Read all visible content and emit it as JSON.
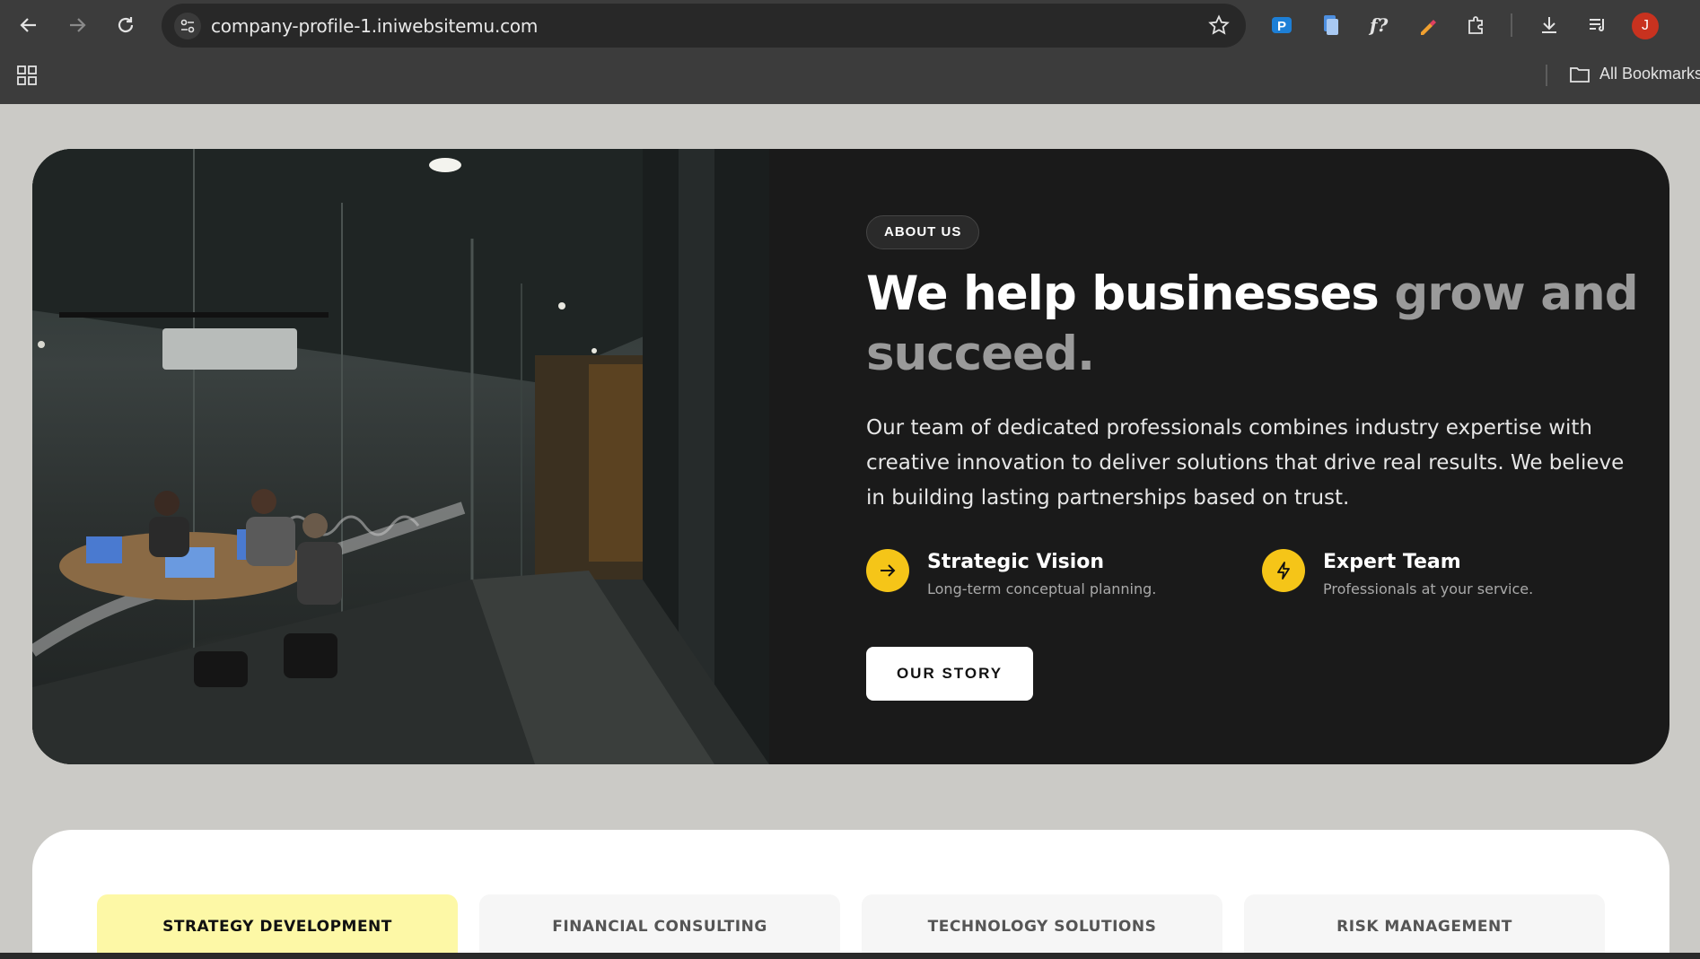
{
  "browser": {
    "url": "company-profile-1.iniwebsitemu.com",
    "bookmarks_label": "All Bookmarks",
    "avatar_letter": "J"
  },
  "hero": {
    "badge": "ABOUT US",
    "headline_main": "We help businesses ",
    "headline_muted": "grow and succeed.",
    "description": "Our team of dedicated professionals combines industry expertise with creative innovation to deliver solutions that drive real results. We believe in building lasting partnerships based on trust.",
    "features": [
      {
        "title": "Strategic Vision",
        "subtitle": "Long-term conceptual planning.",
        "icon": "arrow-right-icon"
      },
      {
        "title": "Expert Team",
        "subtitle": "Professionals at your service.",
        "icon": "lightning-icon"
      }
    ],
    "cta_label": "OUR STORY"
  },
  "services": {
    "tabs": [
      {
        "label": "STRATEGY DEVELOPMENT",
        "active": true
      },
      {
        "label": "FINANCIAL CONSULTING",
        "active": false
      },
      {
        "label": "TECHNOLOGY SOLUTIONS",
        "active": false
      },
      {
        "label": "RISK MANAGEMENT",
        "active": false
      }
    ]
  },
  "colors": {
    "accent_yellow": "#f5c518",
    "active_tab_bg": "#fdf8a6",
    "hero_bg": "#1a1a1a",
    "page_bg": "#cbcac6"
  }
}
